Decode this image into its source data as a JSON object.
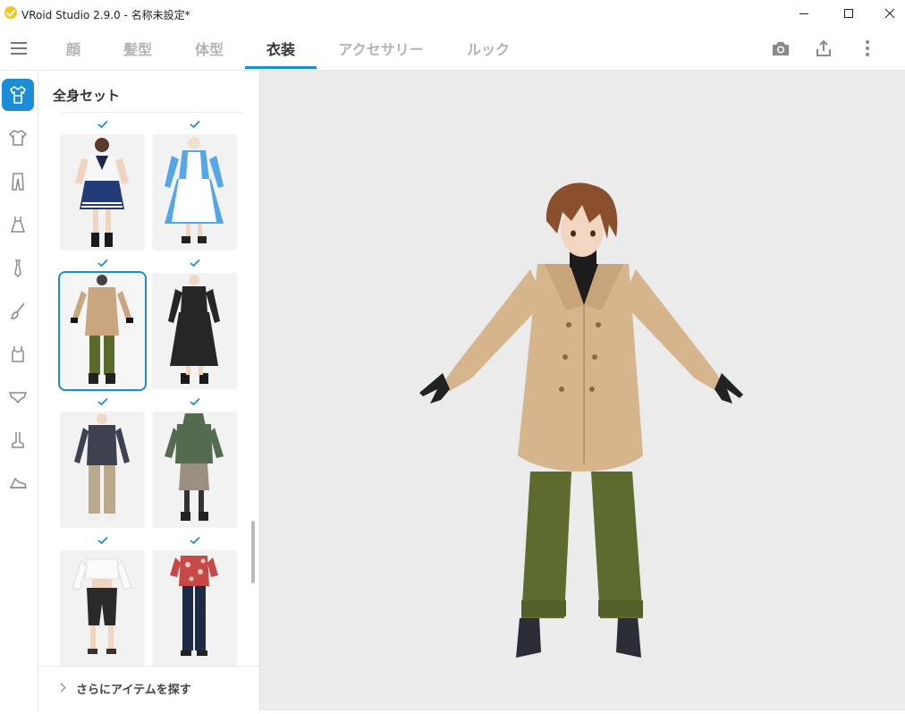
{
  "window": {
    "title": "VRoid Studio 2.9.0 - 名称未設定*",
    "controls": [
      "minimize-icon",
      "maximize-icon",
      "close-icon"
    ]
  },
  "tabs": [
    {
      "label": "顔",
      "active": false
    },
    {
      "label": "髪型",
      "active": false
    },
    {
      "label": "体型",
      "active": false
    },
    {
      "label": "衣装",
      "active": true
    },
    {
      "label": "アクセサリー",
      "active": false
    },
    {
      "label": "ルック",
      "active": false
    }
  ],
  "toolbar": {
    "icons": [
      "camera-icon",
      "export-icon",
      "more-vert-icon"
    ]
  },
  "rail": {
    "items": [
      {
        "icon": "full-set-icon",
        "active": true
      },
      {
        "icon": "tops-icon",
        "active": false
      },
      {
        "icon": "pants-icon",
        "active": false
      },
      {
        "icon": "onepiece-icon",
        "active": false
      },
      {
        "icon": "tie-icon",
        "active": false
      },
      {
        "icon": "brush-icon",
        "active": false
      },
      {
        "icon": "inner-icon",
        "active": false
      },
      {
        "icon": "underwear-icon",
        "active": false
      },
      {
        "icon": "socks-icon",
        "active": false
      },
      {
        "icon": "shoes-icon",
        "active": false
      }
    ]
  },
  "panel": {
    "title": "全身セット",
    "footer_label": "さらにアイテムを探す",
    "items": [
      {
        "name": "sailor-uniform",
        "checked": true,
        "selected": false
      },
      {
        "name": "maid-dress",
        "checked": true,
        "selected": false
      },
      {
        "name": "trench-coat",
        "checked": true,
        "selected": true
      },
      {
        "name": "black-long-dress",
        "checked": true,
        "selected": false
      },
      {
        "name": "dark-shirt-outfit",
        "checked": true,
        "selected": false
      },
      {
        "name": "green-hoodie-skirt",
        "checked": true,
        "selected": false
      },
      {
        "name": "white-crop-top-outfit",
        "checked": true,
        "selected": false
      },
      {
        "name": "floral-shirt-jeans",
        "checked": true,
        "selected": false
      }
    ]
  },
  "colors": {
    "accent": "#1a8cd8",
    "viewport_bg": "#ebebeb",
    "coat": "#d6b48c",
    "pants": "#5e6b2e",
    "hair": "#8a4f2c"
  }
}
